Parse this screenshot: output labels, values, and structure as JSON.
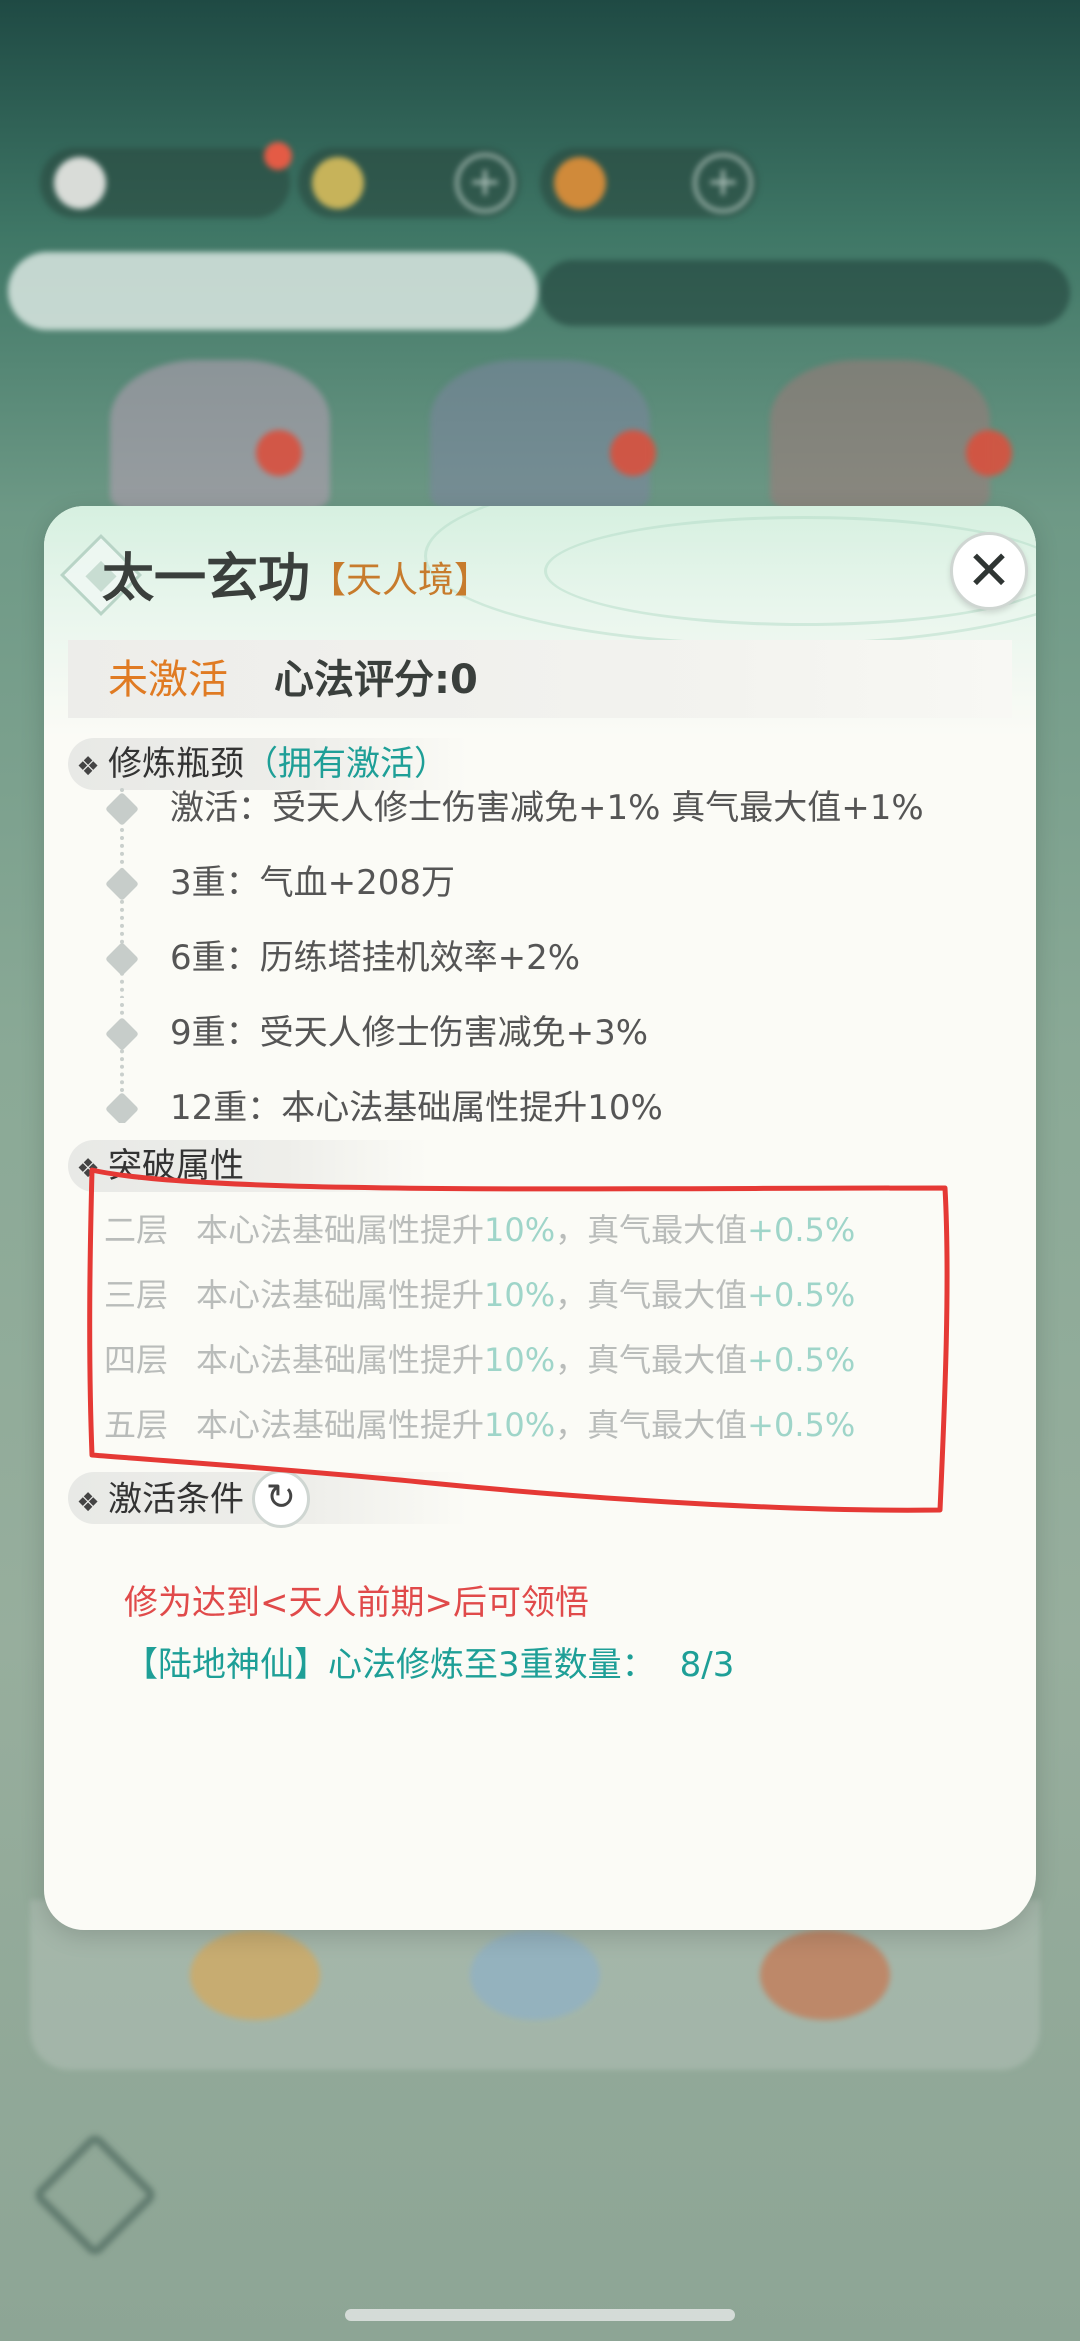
{
  "dialog": {
    "title": "太一玄功",
    "realm_tag": "【天人境】",
    "status_inactive": "未激活",
    "score": "心法评分:0",
    "sections": {
      "bottleneck": {
        "label": "修炼瓶颈",
        "hint": "（拥有激活）",
        "items": [
          "激活：受天人修士伤害减免+1%  真气最大值+1%",
          "3重：气血+208万",
          "6重：历练塔挂机效率+2%",
          "9重：受天人修士伤害减免+3%",
          "12重：本心法基础属性提升10%"
        ]
      },
      "breakthrough": {
        "label": "突破属性",
        "rows": [
          {
            "level": "二层",
            "text_a": "本心法基础属性提升",
            "num_a": "10%",
            "text_b": "，真气最大值",
            "num_b": "+0.5%"
          },
          {
            "level": "三层",
            "text_a": "本心法基础属性提升",
            "num_a": "10%",
            "text_b": "，真气最大值",
            "num_b": "+0.5%"
          },
          {
            "level": "四层",
            "text_a": "本心法基础属性提升",
            "num_a": "10%",
            "text_b": "，真气最大值",
            "num_b": "+0.5%"
          },
          {
            "level": "五层",
            "text_a": "本心法基础属性提升",
            "num_a": "10%",
            "text_b": "，真气最大值",
            "num_b": "+0.5%"
          }
        ]
      },
      "activation": {
        "label": "激活条件",
        "condition_1": "修为达到<天人前期>后可领悟",
        "condition_2": "【陆地神仙】心法修炼至3重数量：",
        "condition_2_progress": "8/3"
      }
    },
    "icons": {
      "close": "close-icon",
      "refresh": "refresh-icon",
      "section": "sparkle-icon",
      "bullet": "diamond-bullet-icon"
    }
  },
  "colors": {
    "accent_orange": "#e07b23",
    "realm_orange": "#c77b2c",
    "teal": "#1e9f97",
    "red": "#e04a4a",
    "annotation_red": "#e53935"
  }
}
